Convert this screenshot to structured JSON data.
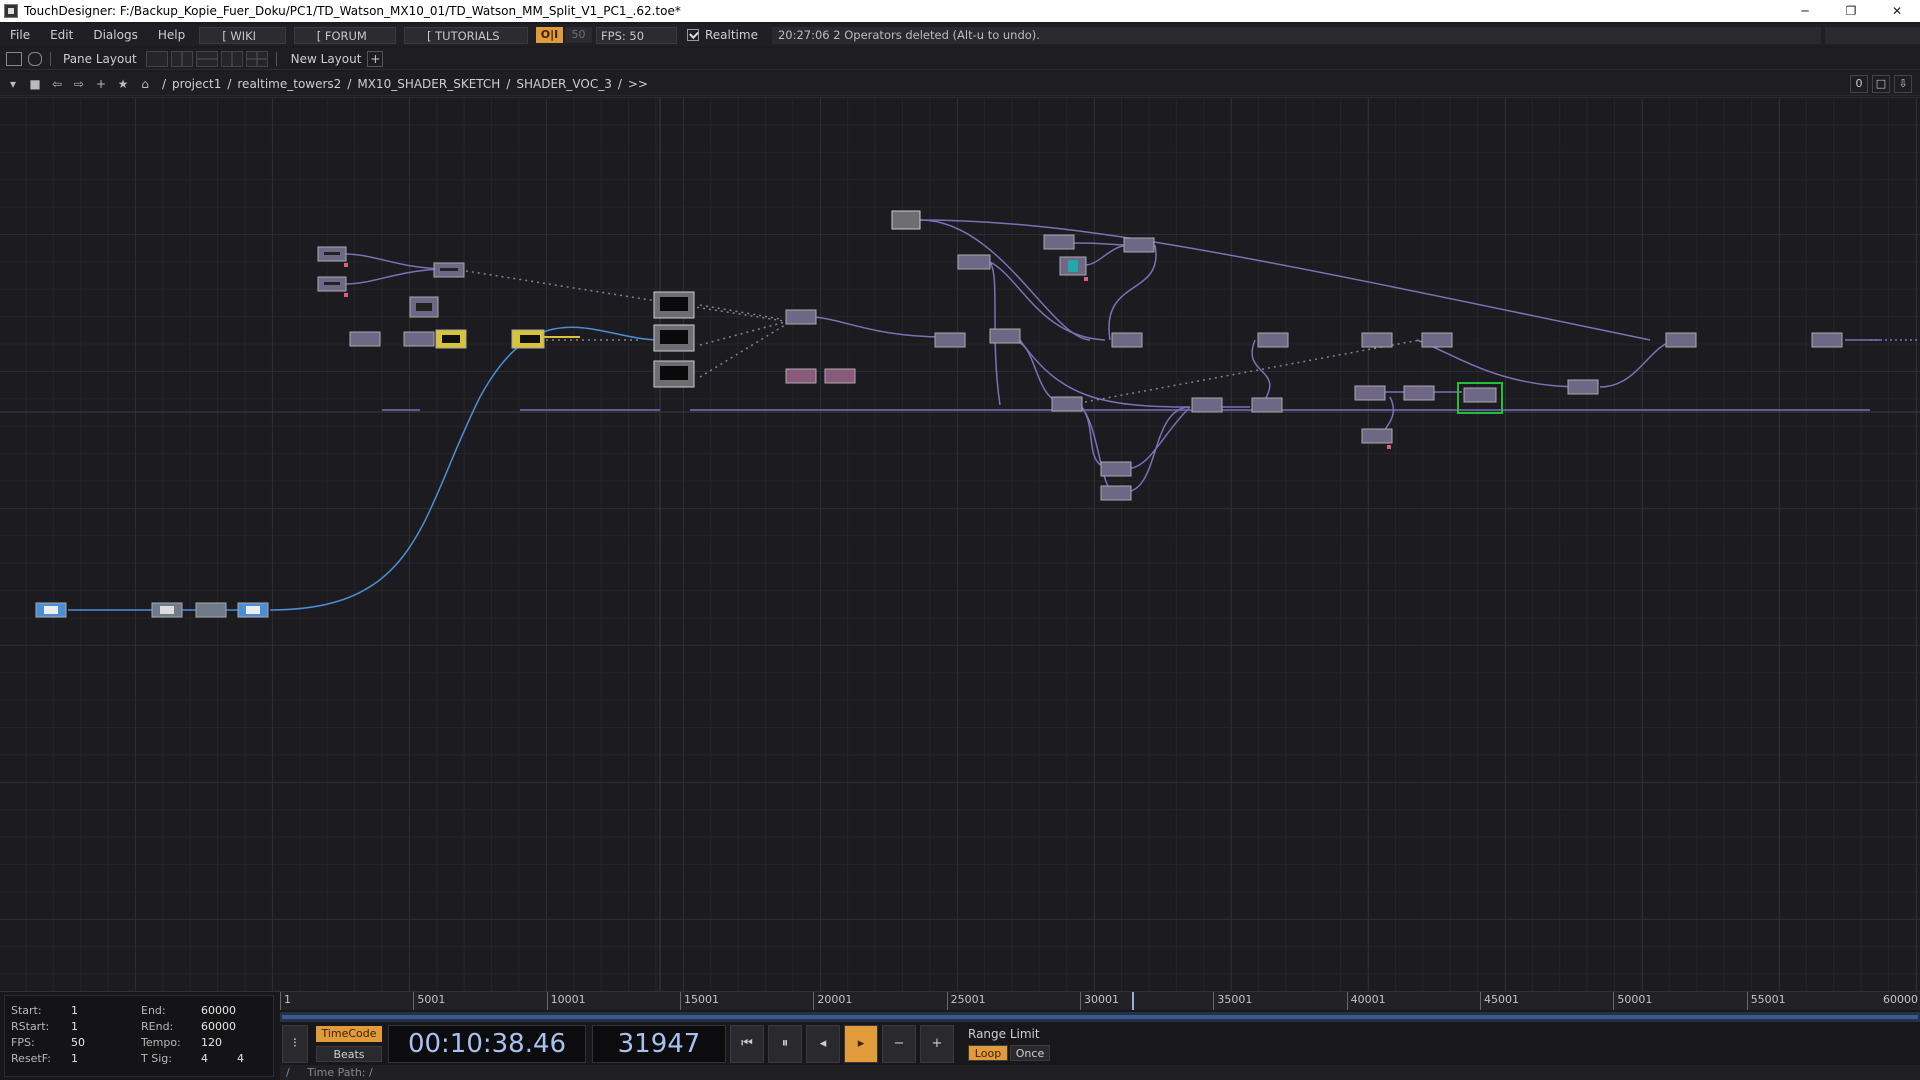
{
  "window": {
    "title": "TouchDesigner: F:/Backup_Kopie_Fuer_Doku/PC1/TD_Watson_MX10_01/TD_Watson_MM_Split_V1_PC1_.62.toe*",
    "minimize": "─",
    "restore": "❐",
    "close": "✕"
  },
  "menu": {
    "file": "File",
    "edit": "Edit",
    "dialogs": "Dialogs",
    "help": "Help",
    "wiki": "[ WIKI ]",
    "forum": "[ FORUM ]",
    "tutorials": "[ TUTORIALS ]",
    "oi": "O|I",
    "fps_limit": "50",
    "fps": "FPS:  50",
    "realtime": "Realtime",
    "status": "20:27:06 2 Operators deleted (Alt-u to undo)."
  },
  "pane": {
    "pane_layout": "Pane Layout",
    "new_layout": "New Layout",
    "plus": "+"
  },
  "path": {
    "crumbs": [
      "/",
      "project1",
      "/",
      "realtime_towers2",
      "/",
      "MX10_SHADER_SKETCH",
      "/",
      "SHADER_VOC_3",
      "/",
      ">>"
    ],
    "right_value": "0"
  },
  "colors": {
    "accent_orange": "#e29b3a",
    "wire_purple": "#7d70b8",
    "wire_blue": "#4a8fd6",
    "wire_yellow": "#d8c43a",
    "selected_green": "#22c03a"
  },
  "timeline": {
    "info": {
      "start_label": "Start:",
      "start": "1",
      "end_label": "End:",
      "end": "60000",
      "rstart_label": "RStart:",
      "rstart": "1",
      "rend_label": "REnd:",
      "rend": "60000",
      "fps_label": "FPS:",
      "fps": "50",
      "tempo_label": "Tempo:",
      "tempo": "120",
      "resetf_label": "ResetF:",
      "resetf": "1",
      "tsig_label": "T Sig:",
      "tsig_a": "4",
      "tsig_b": "4"
    },
    "ruler_ticks": [
      "1",
      "5001",
      "10001",
      "15001",
      "20001",
      "25001",
      "30001",
      "35001",
      "40001",
      "45001",
      "50001",
      "55001",
      "60000"
    ],
    "playhead_frame": 31947,
    "timecode_btn": "TimeCode",
    "beats_btn": "Beats",
    "timecode": "00:10:38.46",
    "frame": "31947",
    "range_limit": "Range Limit",
    "loop": "Loop",
    "once": "Once",
    "time_path_prefix": "/",
    "time_path": "Time Path: /"
  }
}
